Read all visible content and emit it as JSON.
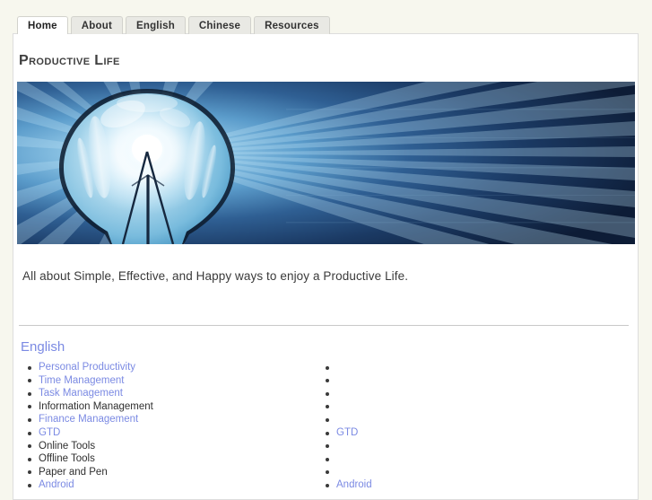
{
  "page": {
    "background_color": "#f7f7ee",
    "panel_background": "#ffffff",
    "link_color": "#7b8ae3",
    "text_color": "#333333",
    "tab_inactive_bg": "#e9e9e4",
    "tab_active_bg": "#ffffff"
  },
  "tabs": [
    {
      "label": "Home",
      "active": true
    },
    {
      "label": "About",
      "active": false
    },
    {
      "label": "English",
      "active": false
    },
    {
      "label": "Chinese",
      "active": false
    },
    {
      "label": "Resources",
      "active": false
    }
  ],
  "header": {
    "site_title": "Productive Life"
  },
  "hero": {
    "alt": "Glowing light bulb with radiating blue light rays",
    "icon": "lightbulb-image"
  },
  "main": {
    "tagline": "All about Simple, Effective, and Happy ways to enjoy a Productive Life.",
    "section_heading": "English",
    "columns": {
      "left": [
        {
          "label": "Personal Productivity",
          "is_link": true
        },
        {
          "label": "Time Management",
          "is_link": true
        },
        {
          "label": "Task Management",
          "is_link": true
        },
        {
          "label": "Information Management",
          "is_link": false
        },
        {
          "label": "Finance Management",
          "is_link": true
        },
        {
          "label": "GTD",
          "is_link": true
        },
        {
          "label": "Online Tools",
          "is_link": false
        },
        {
          "label": "Offline Tools",
          "is_link": false
        },
        {
          "label": "Paper and Pen",
          "is_link": false
        },
        {
          "label": "Android",
          "is_link": true
        }
      ],
      "right": [
        {
          "label": "",
          "is_link": false
        },
        {
          "label": "",
          "is_link": false
        },
        {
          "label": "",
          "is_link": false
        },
        {
          "label": "",
          "is_link": false
        },
        {
          "label": "",
          "is_link": false
        },
        {
          "label": "GTD",
          "is_link": true
        },
        {
          "label": "",
          "is_link": false
        },
        {
          "label": "",
          "is_link": false
        },
        {
          "label": "",
          "is_link": false
        },
        {
          "label": "Android",
          "is_link": true
        }
      ]
    }
  }
}
